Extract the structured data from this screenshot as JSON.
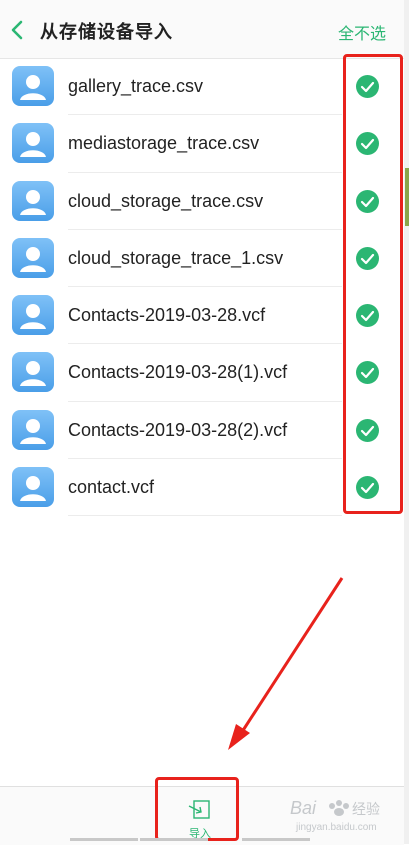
{
  "header": {
    "title": "从存储设备导入",
    "deselect_all_label": "全不选"
  },
  "files": [
    {
      "name": "gallery_trace.csv",
      "checked": true
    },
    {
      "name": "mediastorage_trace.csv",
      "checked": true
    },
    {
      "name": "cloud_storage_trace.csv",
      "checked": true
    },
    {
      "name": "cloud_storage_trace_1.csv",
      "checked": true
    },
    {
      "name": "Contacts-2019-03-28.vcf",
      "checked": true
    },
    {
      "name": "Contacts-2019-03-28(1).vcf",
      "checked": true
    },
    {
      "name": "Contacts-2019-03-28(2).vcf",
      "checked": true
    },
    {
      "name": "contact.vcf",
      "checked": true
    }
  ],
  "footer": {
    "import_label": "导入"
  },
  "watermark": {
    "brand": "Bai百度",
    "site": "jingyan.baidu.com"
  },
  "colors": {
    "accent": "#2bb673",
    "annotation_red": "#e8221c",
    "avatar_blue": "#4a9ee8"
  }
}
